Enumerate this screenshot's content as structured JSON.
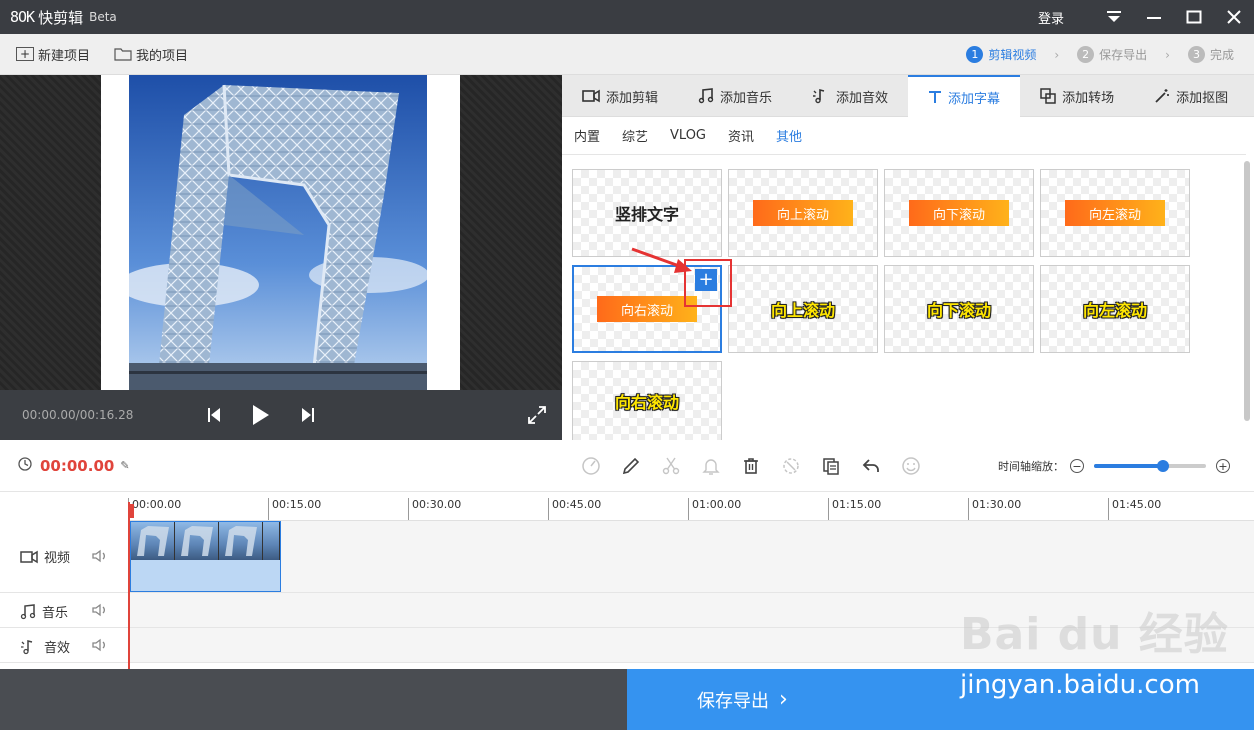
{
  "app": {
    "logo_mark": "8OK",
    "name": "快剪辑",
    "beta": "Beta",
    "login": "登录"
  },
  "toolbar": {
    "new_project": "新建项目",
    "my_projects": "我的项目"
  },
  "steps": [
    {
      "num": "1",
      "label": "剪辑视频",
      "active": true
    },
    {
      "num": "2",
      "label": "保存导出",
      "active": false
    },
    {
      "num": "3",
      "label": "完成",
      "active": false
    }
  ],
  "player": {
    "timecode": "00:00.00/00:16.28"
  },
  "tabs": [
    {
      "label": "添加剪辑",
      "icon": "video-camera-icon"
    },
    {
      "label": "添加音乐",
      "icon": "music-note-icon"
    },
    {
      "label": "添加音效",
      "icon": "sound-effect-icon"
    },
    {
      "label": "添加字幕",
      "icon": "text-t-icon",
      "active": true
    },
    {
      "label": "添加转场",
      "icon": "transition-icon"
    },
    {
      "label": "添加抠图",
      "icon": "magic-wand-icon"
    }
  ],
  "subtabs": [
    {
      "label": "内置"
    },
    {
      "label": "综艺"
    },
    {
      "label": "VLOG"
    },
    {
      "label": "资讯"
    },
    {
      "label": "其他",
      "active": true
    }
  ],
  "captions": [
    {
      "label": "竖排文字",
      "style": "plain"
    },
    {
      "label": "向上滚动",
      "style": "bar"
    },
    {
      "label": "向下滚动",
      "style": "bar"
    },
    {
      "label": "向左滚动",
      "style": "bar"
    },
    {
      "label": "向右滚动",
      "style": "bar",
      "selected": true
    },
    {
      "label": "向上滚动",
      "style": "yellow"
    },
    {
      "label": "向下滚动",
      "style": "yellow"
    },
    {
      "label": "向左滚动",
      "style": "yellow"
    },
    {
      "label": "向右滚动",
      "style": "yellow"
    }
  ],
  "add_button_symbol": "+",
  "edit": {
    "current_time": "00:00.00",
    "zoom_label": "时间轴缩放：",
    "zoom_level": 0.62
  },
  "timeline": {
    "ticks": [
      "00:00.00",
      "00:15.00",
      "00:30.00",
      "00:45.00",
      "01:00.00",
      "01:15.00",
      "01:30.00",
      "01:45.00"
    ]
  },
  "tracks": [
    {
      "label": "视频",
      "icon": "video-camera-icon"
    },
    {
      "label": "音乐",
      "icon": "music-note-icon"
    },
    {
      "label": "音效",
      "icon": "sound-effect-icon"
    }
  ],
  "export": {
    "label": "保存导出",
    "arrow": "›"
  },
  "watermark": {
    "logo": "Bai du 经验",
    "url": "jingyan.baidu.com"
  },
  "colors": {
    "accent": "#2b7de0",
    "time_red": "#e0443b",
    "export_blue": "#3593f0"
  }
}
